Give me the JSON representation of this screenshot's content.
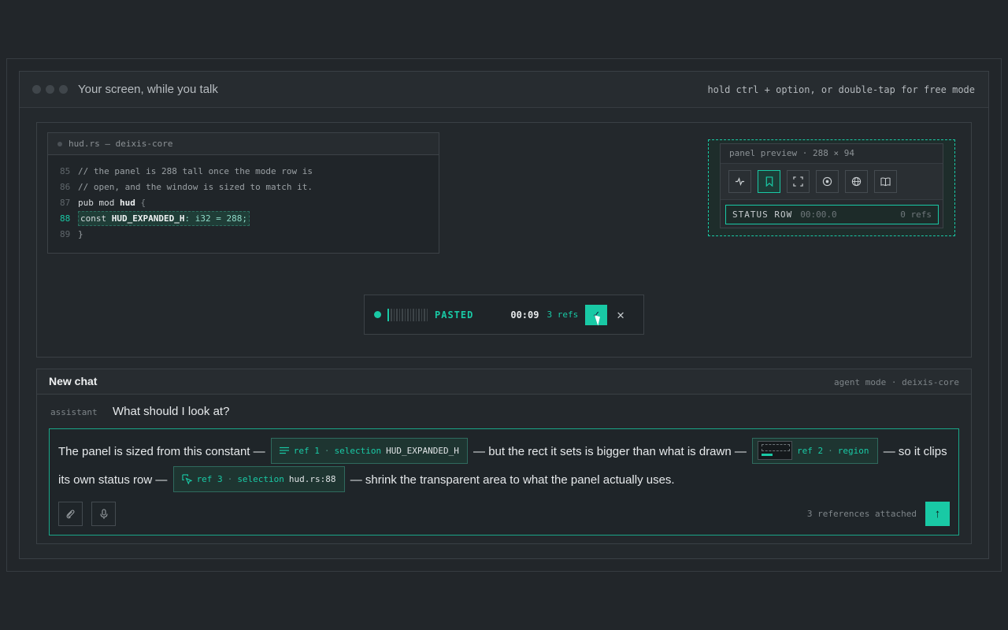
{
  "window": {
    "title": "Your screen, while you talk",
    "hint": "hold ctrl + option, or double-tap for free mode"
  },
  "code_panel": {
    "file_title": "hud.rs — deixis-core",
    "lines": [
      {
        "num": "85",
        "text": "// the panel is 288 tall once the mode row is"
      },
      {
        "num": "86",
        "text": "// open, and the window is sized to match it."
      },
      {
        "num": "87",
        "kw": "pub mod ",
        "name": "hud",
        "rest": " {"
      },
      {
        "num": "88",
        "kw": "const ",
        "name": "HUD_EXPANDED_H",
        "rest": ": i32 = 288;"
      },
      {
        "num": "89",
        "text": "}"
      }
    ]
  },
  "panel_preview": {
    "title": "panel preview · 288 × 94",
    "tools": [
      "pulse-icon",
      "bookmark-icon",
      "region-icon",
      "record-icon",
      "globe-icon",
      "book-icon"
    ],
    "active_tool_index": 1,
    "status_label": "STATUS ROW",
    "status_time": "00:00.0",
    "status_refs": "0 refs"
  },
  "recorder": {
    "state": "PASTED",
    "time": "00:09",
    "refs": "3 refs",
    "confirm_glyph": "✓",
    "close_glyph": "✕"
  },
  "chat": {
    "title": "New chat",
    "mode": "agent mode · deixis-core",
    "role": "assistant",
    "question": "What should I look at?",
    "message": {
      "part1": "The panel is sized from this constant —",
      "ref1": {
        "label": "ref 1",
        "sep": "·",
        "kind": "selection",
        "value": "HUD_EXPANDED_H"
      },
      "part2": "— but the rect it sets is bigger than what is drawn —",
      "ref2": {
        "label": "ref 2",
        "sep": "·",
        "kind": "region"
      },
      "part3": "— so it clips its own status row —",
      "ref3": {
        "label": "ref 3",
        "sep": "·",
        "kind": "selection",
        "value": "hud.rs:88"
      },
      "part4": "— shrink the transparent area to what the panel actually uses."
    },
    "attached": "3 references attached",
    "send_glyph": "↑"
  },
  "colors": {
    "accent": "#19c9a5",
    "background": "#22262a"
  }
}
